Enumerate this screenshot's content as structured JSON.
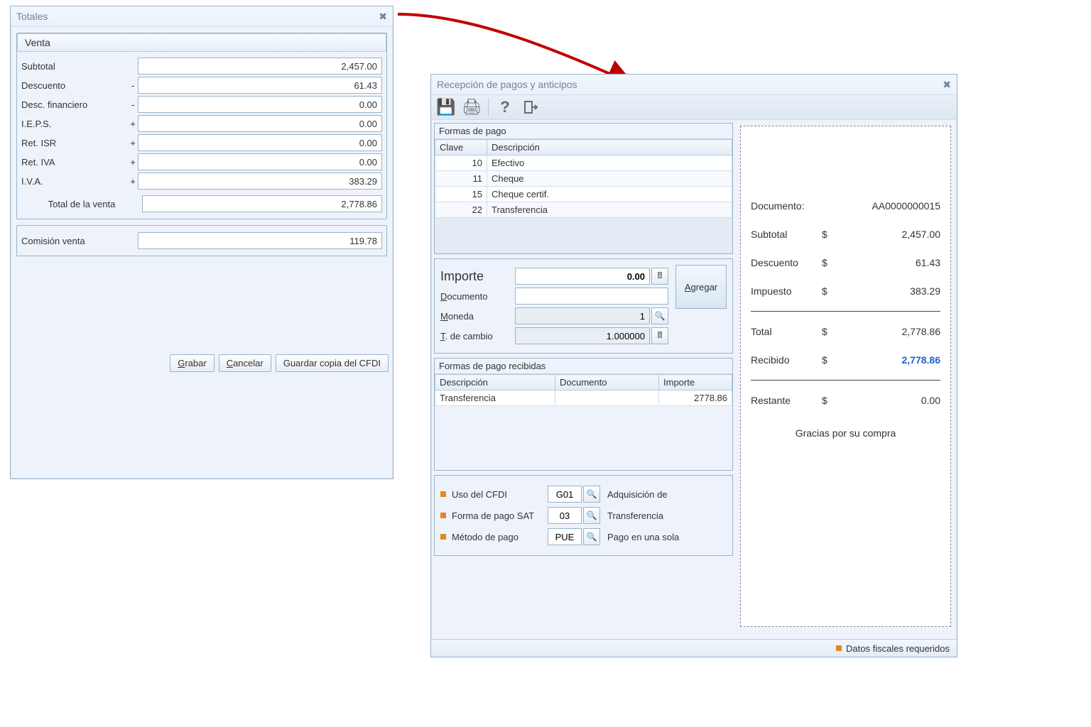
{
  "totales": {
    "title": "Totales",
    "venta_title": "Venta",
    "rows": {
      "subtotal": {
        "label": "Subtotal",
        "sign": "",
        "value": "2,457.00"
      },
      "descuento": {
        "label": "Descuento",
        "sign": "-",
        "value": "61.43"
      },
      "descfin": {
        "label": "Desc. financiero",
        "sign": "-",
        "value": "0.00"
      },
      "ieps": {
        "label": "I.E.P.S.",
        "sign": "+",
        "value": "0.00"
      },
      "retisr": {
        "label": "Ret. ISR",
        "sign": "+",
        "value": "0.00"
      },
      "retiva": {
        "label": "Ret. IVA",
        "sign": "+",
        "value": "0.00"
      },
      "iva": {
        "label": "I.V.A.",
        "sign": "+",
        "value": "383.29"
      }
    },
    "total_label": "Total de la venta",
    "total": "2,778.86",
    "comision_label": "Comisión venta",
    "comision": "119.78",
    "buttons": {
      "grabar": "Grabar",
      "cancelar": "Cancelar",
      "guardar": "Guardar copia del CFDI"
    }
  },
  "recepcion": {
    "title": "Recepción de pagos y anticipos",
    "formas_title": "Formas de pago",
    "formas_cols": {
      "clave": "Clave",
      "desc": "Descripción"
    },
    "formas": [
      {
        "clave": "10",
        "desc": "Efectivo"
      },
      {
        "clave": "11",
        "desc": "Cheque"
      },
      {
        "clave": "15",
        "desc": "Cheque certif."
      },
      {
        "clave": "22",
        "desc": "Transferencia"
      }
    ],
    "importe": {
      "label": "Importe",
      "value": "0.00",
      "doc_label": "Documento",
      "doc_value": "",
      "moneda_label": "Moneda",
      "moneda_value": "1",
      "tc_label": "T. de cambio",
      "tc_value": "1.000000",
      "agregar": "Agregar"
    },
    "recibidas_title": "Formas de pago recibidas",
    "recibidas_cols": {
      "desc": "Descripción",
      "doc": "Documento",
      "imp": "Importe"
    },
    "recibidas": [
      {
        "desc": "Transferencia",
        "doc": "",
        "imp": "2778.86"
      }
    ],
    "fiscal": {
      "uso": {
        "label": "Uso del CFDI",
        "code": "G01",
        "desc": "Adquisición de"
      },
      "forma": {
        "label": "Forma de pago SAT",
        "code": "03",
        "desc": "Transferencia"
      },
      "metodo": {
        "label": "Método de pago",
        "code": "PUE",
        "desc": "Pago en una sola"
      }
    },
    "status": "Datos fiscales requeridos"
  },
  "ticket": {
    "doc_label": "Documento:",
    "doc": "AA0000000015",
    "subtotal_label": "Subtotal",
    "subtotal": "2,457.00",
    "descuento_label": "Descuento",
    "descuento": "61.43",
    "impuesto_label": "Impuesto",
    "impuesto": "383.29",
    "total_label": "Total",
    "total": "2,778.86",
    "recibido_label": "Recibido",
    "recibido": "2,778.86",
    "restante_label": "Restante",
    "restante": "0.00",
    "thanks": "Gracias por su compra",
    "currency": "$"
  }
}
